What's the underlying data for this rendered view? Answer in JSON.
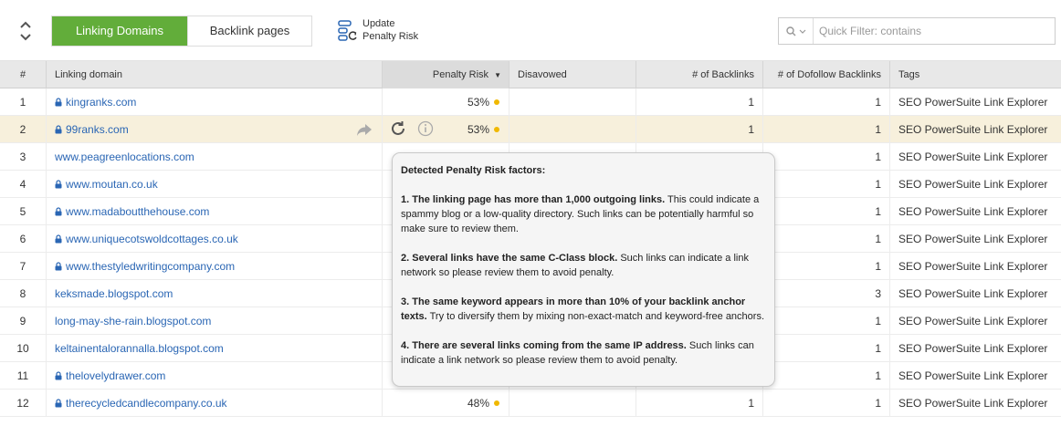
{
  "toolbar": {
    "tabs": [
      {
        "label": "Linking Domains",
        "active": true
      },
      {
        "label": "Backlink pages",
        "active": false
      }
    ],
    "update_line1": "Update",
    "update_line2": "Penalty Risk",
    "filter_placeholder": "Quick Filter: contains"
  },
  "columns": {
    "num": "#",
    "domain": "Linking domain",
    "penalty": "Penalty Risk",
    "disavowed": "Disavowed",
    "backlinks": "# of Backlinks",
    "dofollow": "# of Dofollow Backlinks",
    "tags": "Tags"
  },
  "rows": [
    {
      "num": "1",
      "domain": "kingranks.com",
      "secure": true,
      "penalty": "53%",
      "backlinks": "1",
      "dofollow": "1",
      "tags": "SEO PowerSuite Link Explorer"
    },
    {
      "num": "2",
      "domain": "99ranks.com",
      "secure": true,
      "penalty": "53%",
      "backlinks": "1",
      "dofollow": "1",
      "tags": "SEO PowerSuite Link Explorer"
    },
    {
      "num": "3",
      "domain": "www.peagreenlocations.com",
      "secure": false,
      "penalty": "",
      "backlinks": "",
      "dofollow": "1",
      "tags": "SEO PowerSuite Link Explorer"
    },
    {
      "num": "4",
      "domain": "www.moutan.co.uk",
      "secure": true,
      "penalty": "",
      "backlinks": "",
      "dofollow": "1",
      "tags": "SEO PowerSuite Link Explorer"
    },
    {
      "num": "5",
      "domain": "www.madaboutthehouse.com",
      "secure": true,
      "penalty": "",
      "backlinks": "",
      "dofollow": "1",
      "tags": "SEO PowerSuite Link Explorer"
    },
    {
      "num": "6",
      "domain": "www.uniquecotswoldcottages.co.uk",
      "secure": true,
      "penalty": "",
      "backlinks": "",
      "dofollow": "1",
      "tags": "SEO PowerSuite Link Explorer"
    },
    {
      "num": "7",
      "domain": "www.thestyledwritingcompany.com",
      "secure": true,
      "penalty": "",
      "backlinks": "",
      "dofollow": "1",
      "tags": "SEO PowerSuite Link Explorer"
    },
    {
      "num": "8",
      "domain": "keksmade.blogspot.com",
      "secure": false,
      "penalty": "",
      "backlinks": "",
      "dofollow": "3",
      "tags": "SEO PowerSuite Link Explorer"
    },
    {
      "num": "9",
      "domain": "long-may-she-rain.blogspot.com",
      "secure": false,
      "penalty": "",
      "backlinks": "",
      "dofollow": "1",
      "tags": "SEO PowerSuite Link Explorer"
    },
    {
      "num": "10",
      "domain": "keltainentalorannalla.blogspot.com",
      "secure": false,
      "penalty": "",
      "backlinks": "",
      "dofollow": "1",
      "tags": "SEO PowerSuite Link Explorer"
    },
    {
      "num": "11",
      "domain": "thelovelydrawer.com",
      "secure": true,
      "penalty": "",
      "backlinks": "",
      "dofollow": "1",
      "tags": "SEO PowerSuite Link Explorer"
    },
    {
      "num": "12",
      "domain": "therecycledcandlecompany.co.uk",
      "secure": true,
      "penalty": "48%",
      "backlinks": "1",
      "dofollow": "1",
      "tags": "SEO PowerSuite Link Explorer"
    }
  ],
  "tooltip": {
    "title": "Detected Penalty Risk factors:",
    "items": [
      {
        "n": "1",
        "bold": "The linking page has more than 1,000 outgoing links.",
        "rest": " This could indicate a spammy blog or a low-quality directory. Such links can be potentially harmful so make sure to review them."
      },
      {
        "n": "2",
        "bold": "Several links have the same C-Class block.",
        "rest": " Such links can indicate a link network so please review them to avoid penalty."
      },
      {
        "n": "3",
        "bold": "The same keyword appears in more than 10% of your backlink anchor texts.",
        "rest": " Try to diversify them by mixing non-exact-match and keyword-free anchors."
      },
      {
        "n": "4",
        "bold": "There are several links coming from the same IP address.",
        "rest": " Such links can indicate a link network so please review them to avoid penalty."
      }
    ]
  },
  "colors": {
    "accent": "#62ad3a",
    "link": "#2a66b4",
    "risk_dot": "#f0b800",
    "highlight_row": "#f7f0dc"
  },
  "icons": [
    "sort-toggle-icon",
    "update-penalty-icon",
    "search-icon",
    "lock-icon",
    "share-icon",
    "refresh-icon",
    "info-icon"
  ]
}
